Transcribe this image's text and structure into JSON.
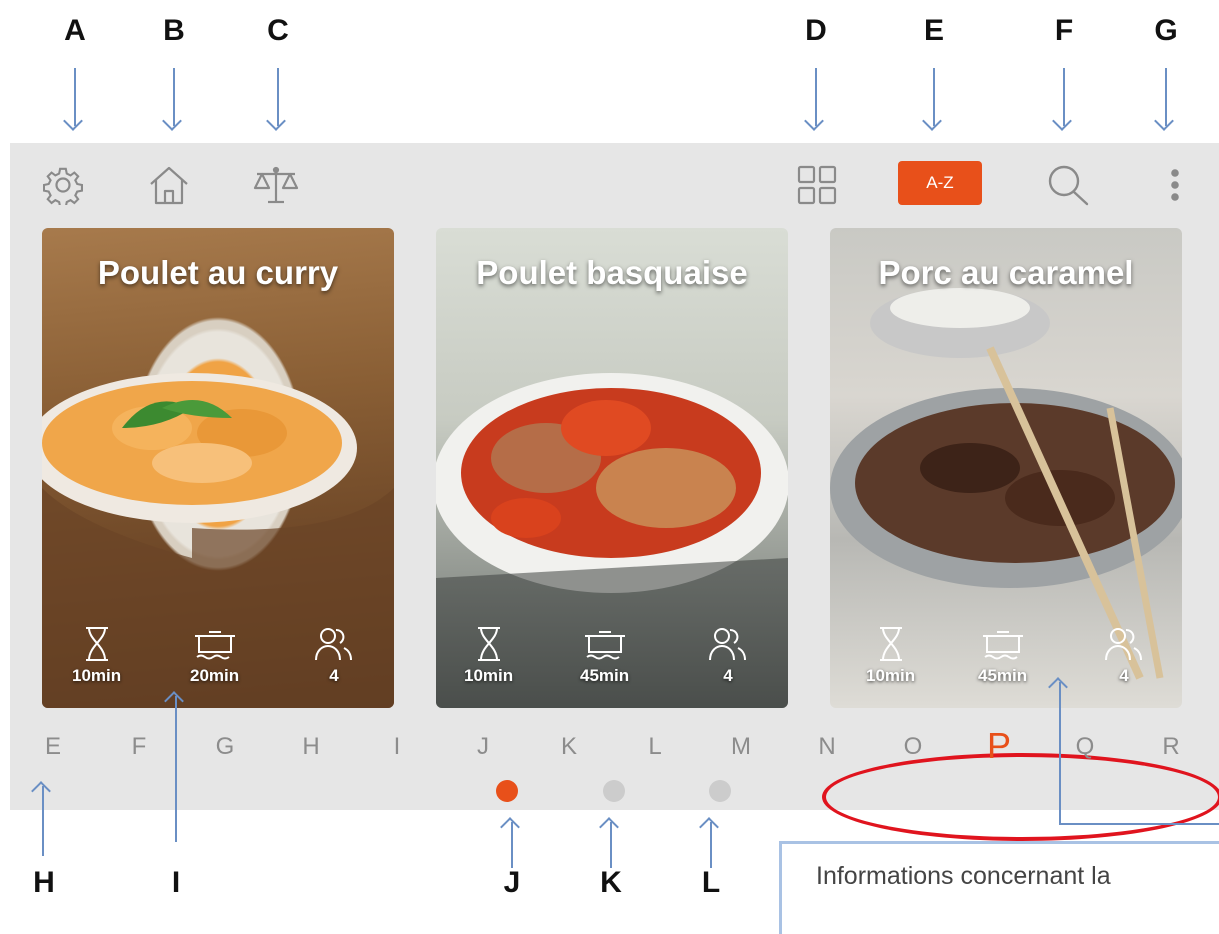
{
  "callouts": {
    "A": "A",
    "B": "B",
    "C": "C",
    "D": "D",
    "E": "E",
    "F": "F",
    "G": "G",
    "H": "H",
    "I": "I",
    "J": "J",
    "K": "K",
    "L": "L"
  },
  "toolbar": {
    "settings_icon": "gear-icon",
    "home_icon": "home-icon",
    "scale_icon": "scale-icon",
    "grid_icon": "grid-icon",
    "sort_label": "A-Z",
    "search_icon": "search-icon",
    "more_icon": "more-vertical-icon",
    "accent_color": "#e8501a"
  },
  "recipes": [
    {
      "title": "Poulet au curry",
      "prep": "10min",
      "cook": "20min",
      "servings": "4"
    },
    {
      "title": "Poulet basquaise",
      "prep": "10min",
      "cook": "45min",
      "servings": "4"
    },
    {
      "title": "Porc au caramel",
      "prep": "10min",
      "cook": "45min",
      "servings": "4"
    }
  ],
  "alphabet": [
    "E",
    "F",
    "G",
    "H",
    "I",
    "J",
    "K",
    "L",
    "M",
    "N",
    "O",
    "P",
    "Q",
    "R"
  ],
  "alphabet_active": "P",
  "pagination": {
    "pages": 3,
    "current": 1
  },
  "annotation": {
    "text": "Informations concernant la"
  }
}
